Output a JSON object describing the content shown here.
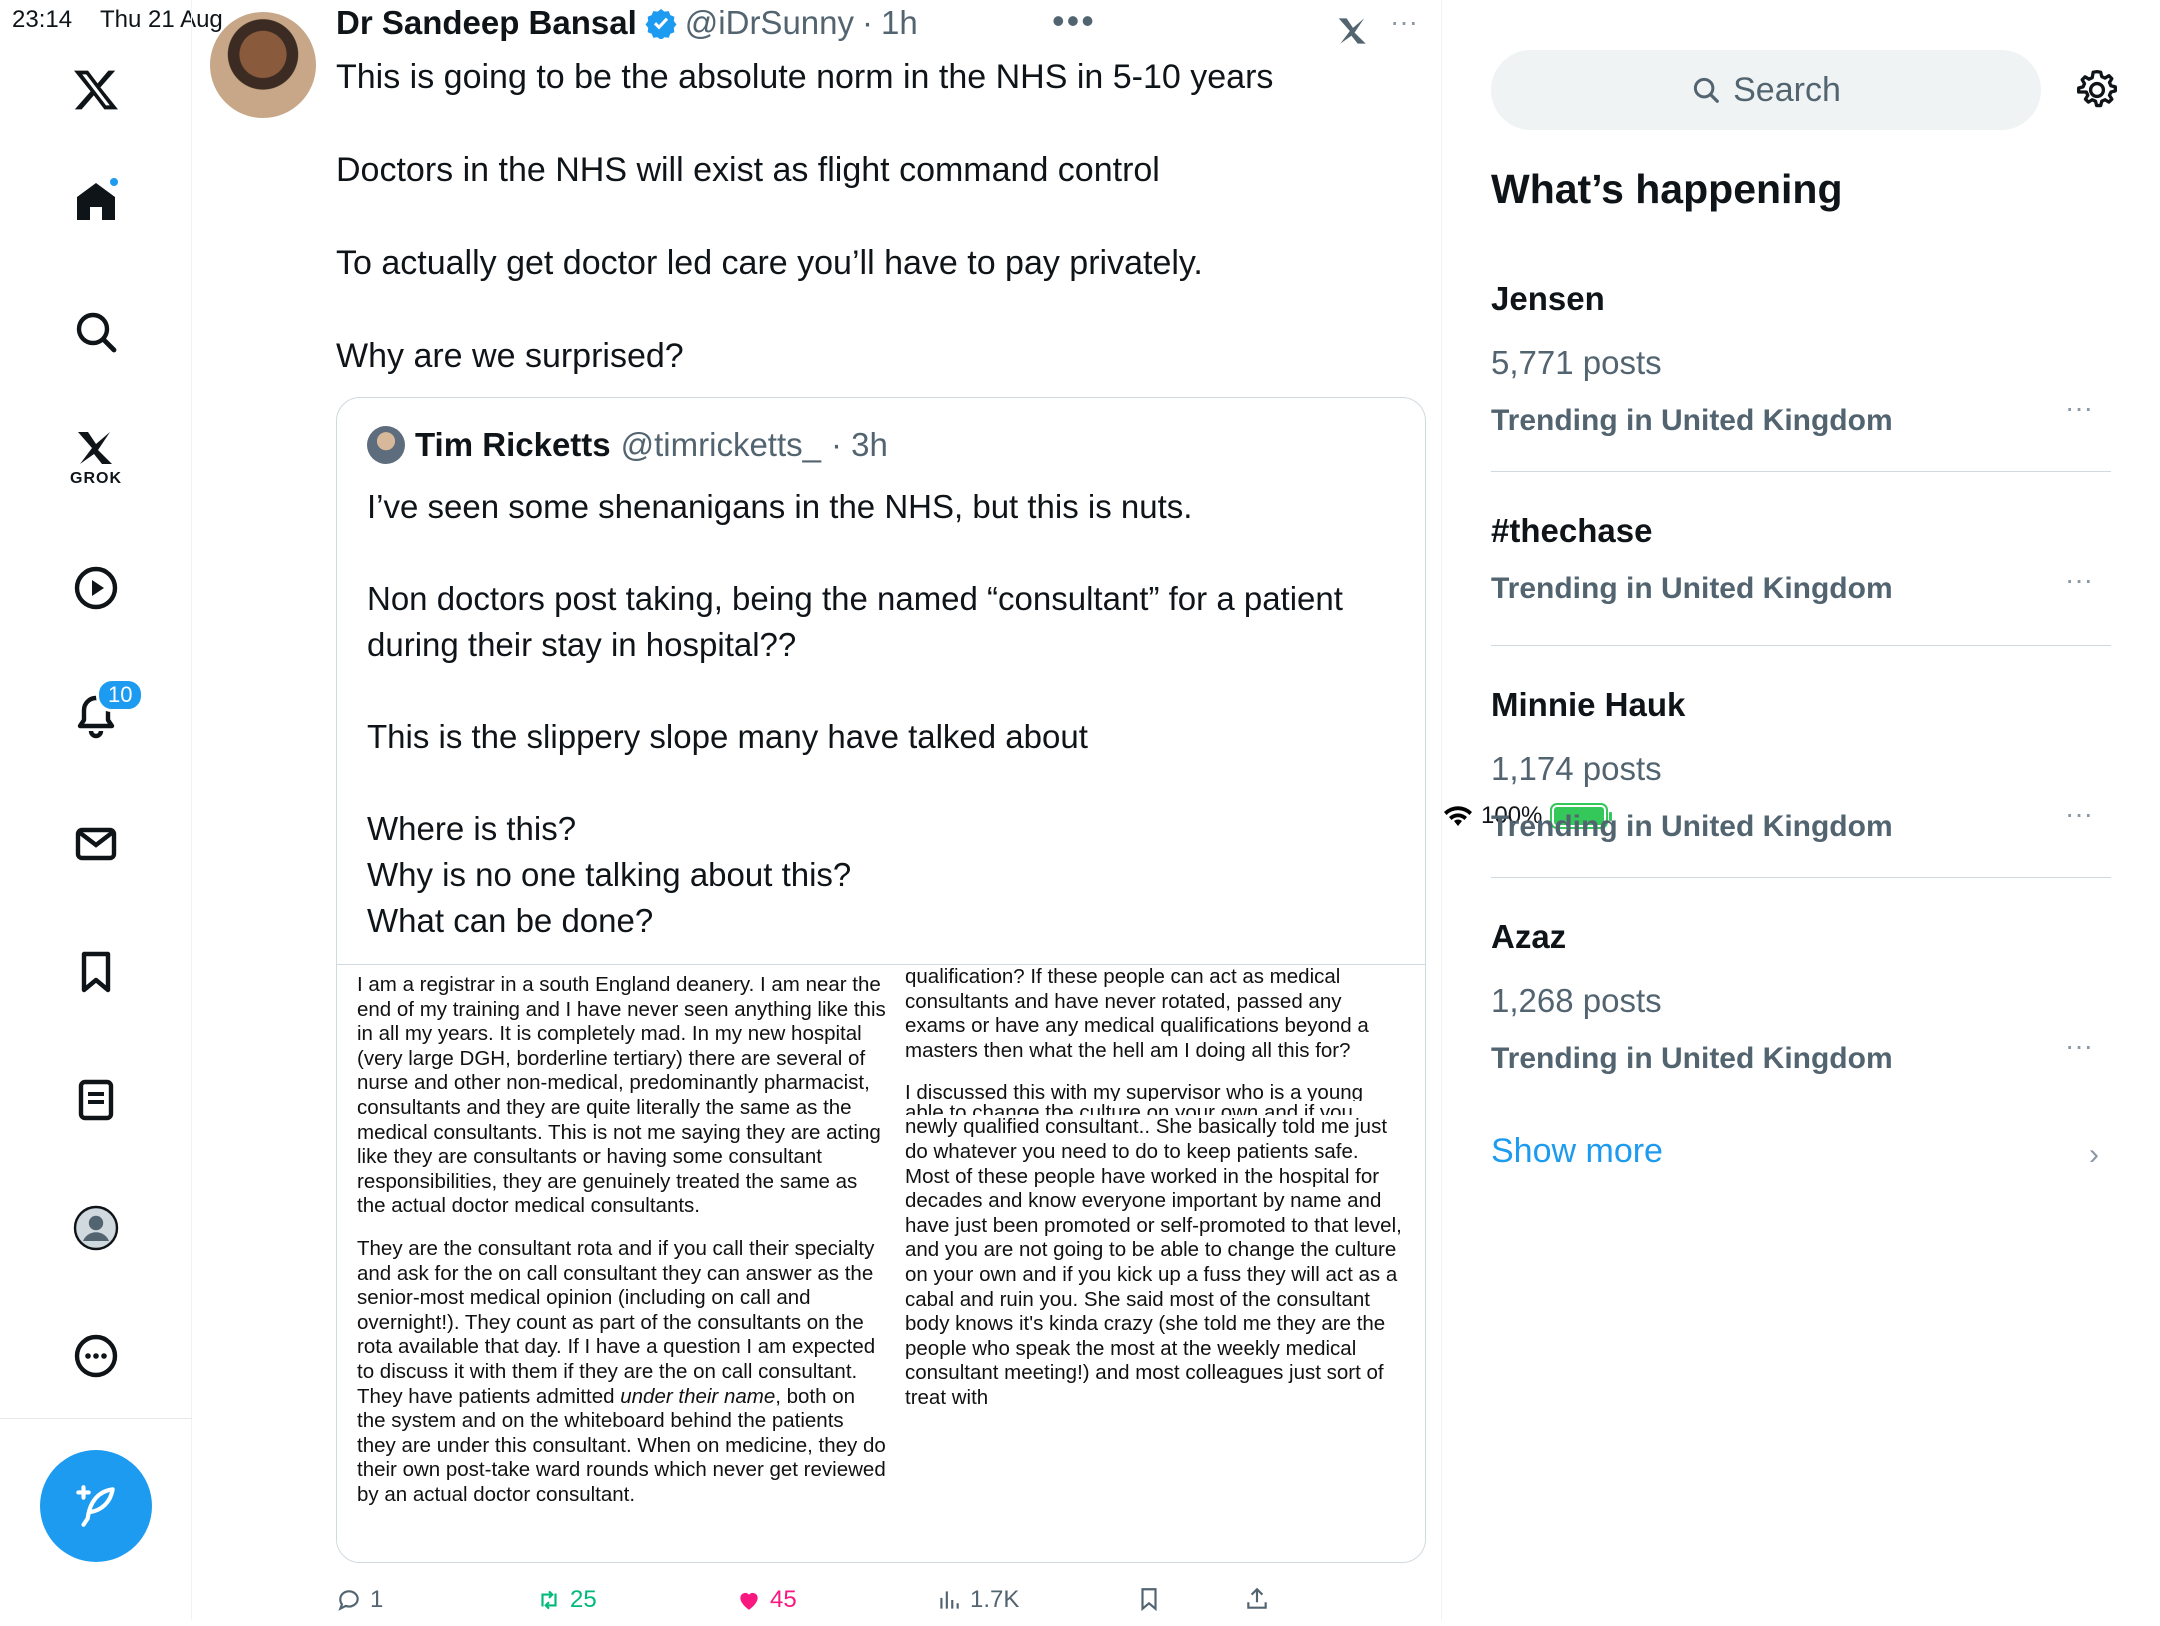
{
  "status_bar": {
    "time": "23:14",
    "date": "Thu 21 Aug",
    "battery": "100%"
  },
  "sidebar": {
    "notifications_badge": "10",
    "grok_label": "GROK"
  },
  "tweet": {
    "author_name": "Dr Sandeep Bansal",
    "handle": "@iDrSunny",
    "separator": "·",
    "time": "1h",
    "paragraphs": [
      "This is going to be the absolute norm in the NHS in 5-10 years",
      "Doctors in the NHS will exist as flight command control",
      "To actually get doctor led care you’ll have to pay privately.",
      "Why are we surprised?"
    ],
    "quote": {
      "author_name": "Tim Ricketts",
      "handle": "@timricketts_",
      "time": "· 3h",
      "lines": [
        "I’ve seen some shenanigans in the NHS, but this is nuts.",
        "Non doctors post taking, being the named “consultant” for a patient during their stay in hospital??",
        "This is the slippery slope many have talked about",
        "Where is this?",
        "Why is no one talking about this?",
        "What can be done?"
      ],
      "document": {
        "col1_p1": "I am a registrar in a south England deanery. I am near the end of my training and I have never seen anything like this in all my years. It is completely mad. In my new hospital (very large DGH, borderline tertiary) there are several of nurse and other non-medical, predominantly pharmacist, consultants and they are quite literally the same as the medical consultants. This is not me saying they are acting like they are consultants or having some consultant responsibilities, they are genuinely treated the same as the actual doctor medical consultants.",
        "col1_p2a": "They are the consultant rota and if you call their specialty and ask for the on call consultant they can answer as the senior-most medical opinion (including on call and overnight!). They count as part of the consultants on the rota available that day. If I have a question I am expected to discuss it with them if they are the on call consultant. They have patients admitted ",
        "col1_p2_italic": "under their name",
        "col1_p2b": ", both on the system and on the whiteboard behind the patients they are under this consultant. When on medicine, they do their own post-take ward rounds which never get reviewed by an actual doctor consultant.",
        "col2_p1": "qualification? If these people can act as medical consultants and have never rotated, passed any exams or have any medical qualifications beyond a masters then what the hell am I doing all this for?",
        "col2_p2": "I discussed this with my supervisor who is a young newly qualified consultant.. She basically told me just do whatever you need to do to keep patients safe. Most of these people have worked in the hospital for decades and know everyone important by name and have just been promoted or self-promoted to that level, and you are not going to be",
        "col2_cut": "able to change the culture on your own and if you",
        "col2_p3": "newly qualified consultant.. She basically told me just do whatever you need to do to keep patients safe. Most of these people have worked in the hospital for decades and know everyone important by name and have just been promoted or self-promoted to that level, and you are not going to be able to change the culture on your own and if you kick up a fuss they will act as a cabal and ruin you. She said most of the consultant body knows it's kinda crazy (she told me they are the people who speak the most at the weekly medical consultant meeting!) and most colleagues just sort of treat with"
      }
    },
    "actions": {
      "replies": "1",
      "reposts": "25",
      "likes": "45",
      "views": "1.7K"
    }
  },
  "right_panel": {
    "search_placeholder": "Search",
    "section_title": "What’s happening",
    "trends": [
      {
        "title": "Jensen",
        "posts": "5,771 posts",
        "meta": "Trending in United Kingdom"
      },
      {
        "title": "#thechase",
        "posts": "",
        "meta": "Trending in United Kingdom"
      },
      {
        "title": "Minnie Hauk",
        "posts": "1,174 posts",
        "meta": "Trending in United Kingdom"
      },
      {
        "title": "Azaz",
        "posts": "1,268 posts",
        "meta": "Trending in United Kingdom"
      }
    ],
    "show_more": "Show more"
  },
  "colors": {
    "accent": "#1d9bf0",
    "repost": "#00ba7c",
    "like": "#f91880",
    "muted": "#536471"
  }
}
